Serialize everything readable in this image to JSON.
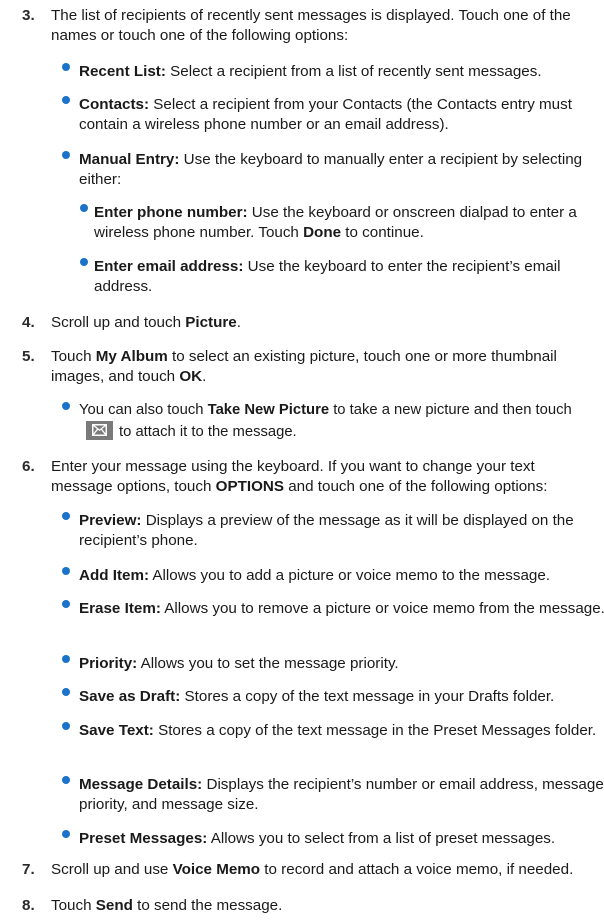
{
  "steps": [
    {
      "num": "3.",
      "text": "The list of recipients of recently sent messages is displayed. Touch one of the names or touch one of the following options:"
    },
    {
      "num": "4.",
      "pre": "Scroll up and touch ",
      "bold": "Picture",
      "post": "."
    },
    {
      "num": "5.",
      "pre": "Touch ",
      "bold": "My Album",
      "mid": " to select an existing picture, touch one or more thumbnail images, and touch ",
      "bold2": "OK",
      "post": "."
    },
    {
      "num": "6.",
      "pre": "Enter your message using the keyboard. If you want to change your text message options, touch ",
      "bold": "OPTIONS",
      "post": " and touch one of the following options:"
    },
    {
      "num": "7.",
      "pre": "Scroll up and use ",
      "bold": "Voice Memo",
      "post": " to record and attach a voice memo, if needed."
    },
    {
      "num": "8.",
      "pre": "Touch ",
      "bold": "Send",
      "post": " to send the message."
    }
  ],
  "step3_bullets": [
    {
      "label": "Recent List:",
      "text": " Select a recipient from a list of recently sent messages."
    },
    {
      "label": "Contacts:",
      "text": " Select a recipient from your Contacts (the Contacts entry must contain a wireless phone number or an email address)."
    },
    {
      "label": "Manual Entry:",
      "text": " Use the keyboard to manually enter a recipient by selecting either:"
    }
  ],
  "manual_sub": [
    {
      "label": "Enter phone number:",
      "text": " Use the keyboard or onscreen dialpad to enter a wireless phone number. Touch ",
      "bold": "Done",
      "post": " to continue."
    },
    {
      "label": "Enter email address:",
      "text": " Use the keyboard to enter the recipient’s email address."
    }
  ],
  "step5_note": {
    "pre": "You can also touch ",
    "bold": "Take New Picture",
    "mid": " to take a new picture and then touch",
    "post": "to attach it to the message.",
    "icon": "envelope-icon"
  },
  "step6_bullets": [
    {
      "label": "Preview:",
      "text": " Displays a preview of the message as it will be displayed on the recipient’s phone."
    },
    {
      "label": "Add Item:",
      "text": " Allows you to add a picture or voice memo to the message."
    },
    {
      "label": "Erase Item:",
      "text": " Allows you to remove a picture or voice memo from the message."
    },
    {
      "label": "Priority:",
      "text": " Allows you to set the message priority."
    },
    {
      "label": "Save as Draft:",
      "text": " Stores a copy of the text message in your Drafts folder."
    },
    {
      "label": "Save Text:",
      "text": " Stores a copy of the text message in the Preset Messages folder."
    },
    {
      "label": "Message Details:",
      "text": " Displays the recipient’s number or email address, message priority, and message size."
    },
    {
      "label": "Preset Messages:",
      "text": " Allows you to select from a list of preset messages."
    }
  ],
  "colors": {
    "bullet": "#1a73c8",
    "icon_bg": "#7a7a7a"
  }
}
